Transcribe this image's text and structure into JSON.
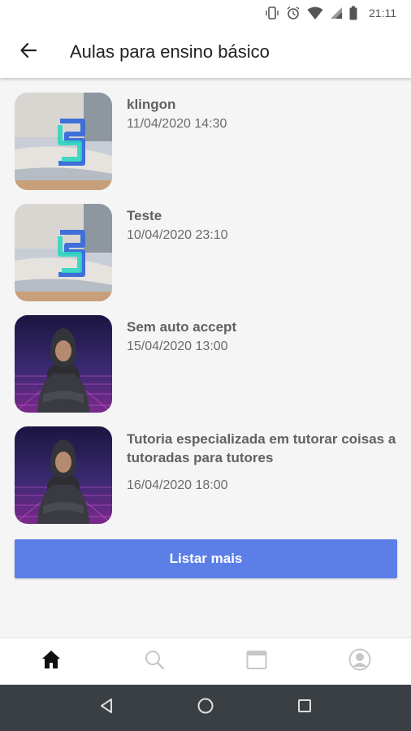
{
  "status_bar": {
    "time": "21:11",
    "icons": [
      "vibrate-icon",
      "alarm-icon",
      "wifi-icon",
      "signal-icon",
      "battery-icon"
    ]
  },
  "app_bar": {
    "title": "Aulas para ensino básico",
    "back_icon": "arrow-left-icon"
  },
  "lessons": [
    {
      "title": "klingon",
      "date": "11/04/2020 14:30",
      "thumbnail": "study-logo"
    },
    {
      "title": "Teste",
      "date": "10/04/2020 23:10",
      "thumbnail": "study-logo"
    },
    {
      "title": "Sem auto accept",
      "date": "15/04/2020 13:00",
      "thumbnail": "hoodie-person"
    },
    {
      "title": "Tutoria especializada em tutorar coisas a tutoradas para tutores",
      "date": "16/04/2020 18:00",
      "thumbnail": "hoodie-person"
    }
  ],
  "list_more_label": "Listar mais",
  "bottom_nav": {
    "items": [
      "home-icon",
      "search-icon",
      "calendar-icon",
      "profile-icon"
    ],
    "active": "home-icon"
  },
  "colors": {
    "accent": "#5b7fe6",
    "system_nav": "#3a3f44"
  }
}
